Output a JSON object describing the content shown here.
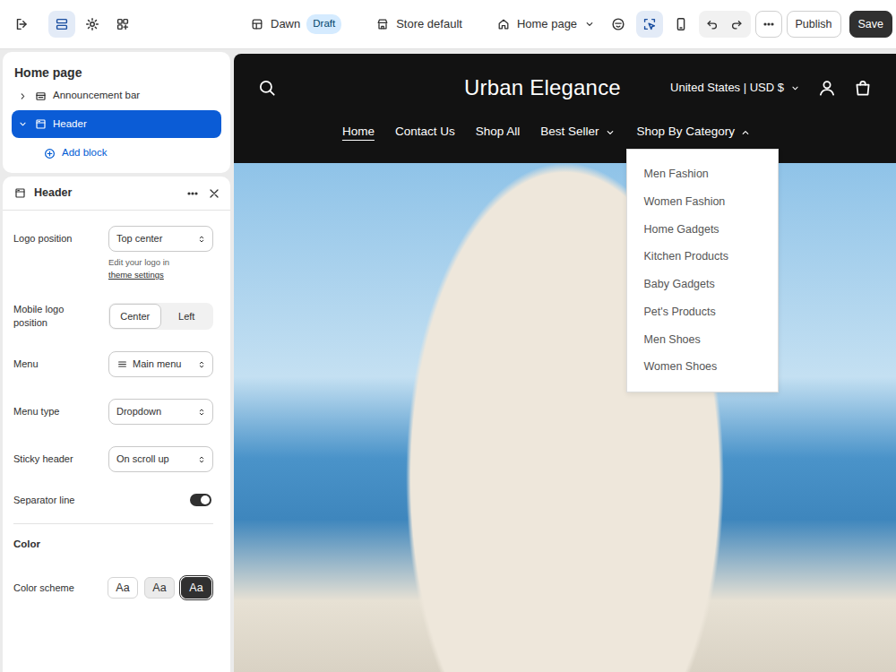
{
  "toolbar": {
    "tools": [
      {
        "selected": false
      },
      {
        "selected": true
      },
      {
        "selected": false
      },
      {
        "selected": false
      }
    ],
    "theme": {
      "name": "Dawn",
      "badge": "Draft"
    },
    "context": "Store default",
    "page": "Home page",
    "view_tools": [
      {
        "selected": false
      },
      {
        "selected": true
      },
      {
        "selected": false
      }
    ],
    "publish": "Publish",
    "save": "Save"
  },
  "sidebar": {
    "title": "Home page",
    "sections": [
      {
        "label": "Announcement bar",
        "expanded": false,
        "selected": false
      },
      {
        "label": "Header",
        "expanded": true,
        "selected": true
      }
    ],
    "add_block": "Add block"
  },
  "settings": {
    "title": "Header",
    "fields": [
      {
        "kind": "select",
        "label": "Logo position",
        "value": "Top center",
        "help": "Edit your logo in",
        "help_link": "theme settings"
      },
      {
        "kind": "segmented",
        "label": "Mobile logo position",
        "options": [
          {
            "label": "Center",
            "selected": true
          },
          {
            "label": "Left",
            "selected": false
          }
        ]
      },
      {
        "kind": "menu",
        "label": "Menu",
        "value": "Main menu"
      },
      {
        "kind": "select",
        "label": "Menu type",
        "value": "Dropdown"
      },
      {
        "kind": "select",
        "label": "Sticky header",
        "value": "On scroll up"
      },
      {
        "kind": "toggle",
        "label": "Separator line",
        "on": true
      }
    ],
    "color_section": "Color",
    "color_scheme": {
      "label": "Color scheme",
      "swatches": [
        {
          "label": "Aa",
          "selected": false,
          "color": "#ffffff"
        },
        {
          "label": "Aa",
          "selected": false,
          "color": "#ebebeb"
        },
        {
          "label": "Aa",
          "selected": true,
          "color": "#303030"
        }
      ]
    }
  },
  "preview": {
    "store_name": "Urban Elegance",
    "locale": "United States | USD $",
    "nav": [
      {
        "label": "Home",
        "kind": "link",
        "selected": true,
        "expanded": false
      },
      {
        "label": "Contact Us",
        "kind": "link",
        "selected": false,
        "expanded": false
      },
      {
        "label": "Shop All",
        "kind": "link",
        "selected": false,
        "expanded": false
      },
      {
        "label": "Best Seller",
        "kind": "menu",
        "selected": false,
        "expanded": false
      },
      {
        "label": "Shop By Category",
        "kind": "menu",
        "selected": false,
        "expanded": true
      }
    ],
    "dropdown": [
      "Men Fashion",
      "Women Fashion",
      "Home Gadgets",
      "Kitchen Products",
      "Baby Gadgets",
      "Pet's Products",
      "Men Shoes",
      "Women Shoes"
    ]
  }
}
